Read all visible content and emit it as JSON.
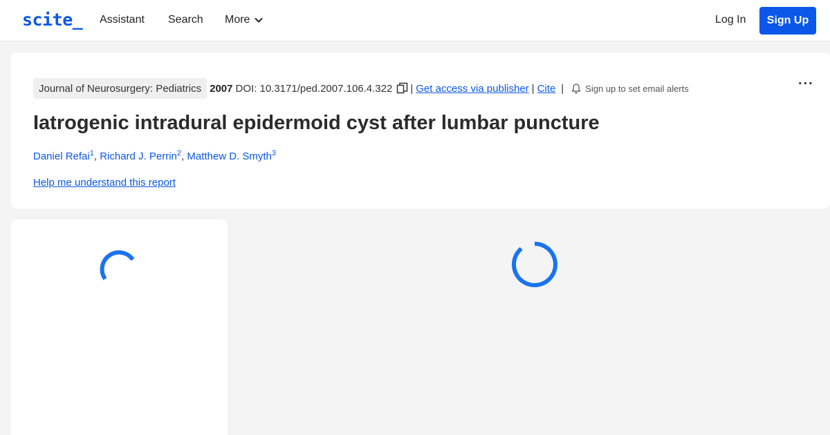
{
  "header": {
    "logo": "scite_",
    "nav": {
      "assistant": "Assistant",
      "search": "Search",
      "more": "More"
    },
    "login": "Log In",
    "signup": "Sign Up"
  },
  "paper": {
    "journal": "Journal of Neurosurgery: Pediatrics",
    "year": "2007",
    "doi": "DOI: 10.3171/ped.2007.106.4.322",
    "separator": "|",
    "access_link": "Get access via publisher",
    "cite_link": "Cite",
    "alerts_text": "Sign up to set email alerts",
    "more_menu": "...",
    "title": "Iatrogenic intradural epidermoid cyst after lumbar puncture",
    "authors": [
      {
        "name": "Daniel Refai",
        "sup": "1"
      },
      {
        "name": "Richard J. Perrin",
        "sup": "2"
      },
      {
        "name": "Matthew D. Smyth",
        "sup": "3"
      }
    ],
    "author_separator": ", ",
    "help_link": "Help me understand this report"
  },
  "icons": {
    "copy": "copy-icon",
    "bell": "bell-icon",
    "chevron": "chevron-down-icon",
    "spinner": "loading-spinner"
  },
  "colors": {
    "accent": "#0a57e8",
    "spinner": "#1a73f0",
    "background": "#f4f4f4"
  }
}
